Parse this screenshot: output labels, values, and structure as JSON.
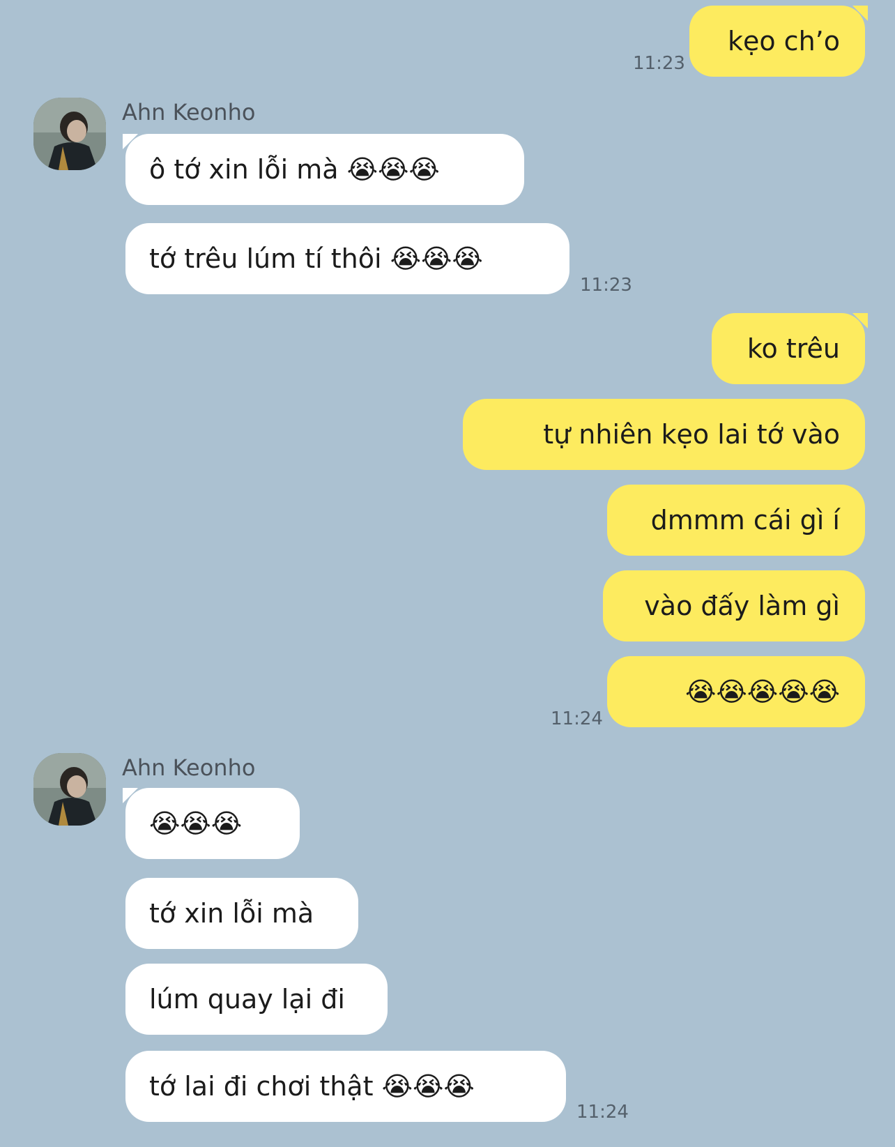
{
  "messages": [
    {
      "text": "kẹo ch’o",
      "time": "11:23"
    },
    {
      "sender": "Ahn Keonho"
    },
    {
      "text": "ô tớ xin lỗi mà 😭😭😭"
    },
    {
      "text": "tớ trêu lúm tí thôi 😭😭😭",
      "time": "11:23"
    },
    {
      "text": "ko trêu"
    },
    {
      "text": "tự nhiên kẹo lai tớ vào"
    },
    {
      "text": "dmmm cái gì í"
    },
    {
      "text": "vào đấy làm gì"
    },
    {
      "text": "😭😭😭😭😭",
      "time": "11:24"
    },
    {
      "sender": "Ahn Keonho"
    },
    {
      "text": "😭😭😭"
    },
    {
      "text": "tớ xin lỗi mà"
    },
    {
      "text": "lúm quay lại đi"
    },
    {
      "text": "tớ lai đi chơi thật 😭😭😭",
      "time": "11:24"
    }
  ],
  "colors": {
    "background": "#abc1d1",
    "outgoing_bubble": "#fdeb5f",
    "incoming_bubble": "#ffffff"
  },
  "icons": {
    "avatar": "profile-photo",
    "emoji": "loudly-crying-face"
  }
}
